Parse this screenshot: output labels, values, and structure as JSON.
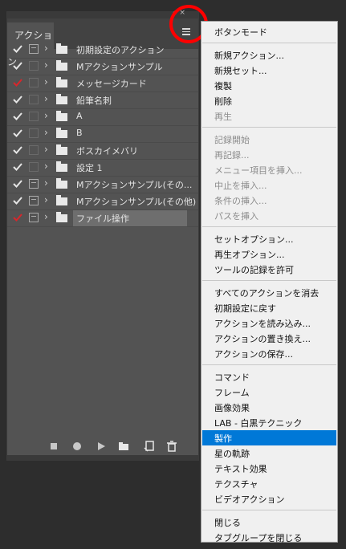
{
  "panel": {
    "tab_label": "アクション",
    "top_controls": "« ×",
    "actions": [
      {
        "label": "初期設定のアクション",
        "check": "white",
        "modal": "on"
      },
      {
        "label": "Mアクションサンプル",
        "check": "white",
        "modal": "empty"
      },
      {
        "label": "メッセージカード",
        "check": "red",
        "modal": "empty"
      },
      {
        "label": "鉛筆名刺",
        "check": "white",
        "modal": "empty"
      },
      {
        "label": "A",
        "check": "white",
        "modal": "empty"
      },
      {
        "label": "B",
        "check": "white",
        "modal": "empty"
      },
      {
        "label": "ボスカイメバリ",
        "check": "white",
        "modal": "empty"
      },
      {
        "label": "設定 1",
        "check": "white",
        "modal": "empty"
      },
      {
        "label": "Mアクションサンプル(その...",
        "check": "white",
        "modal": "on"
      },
      {
        "label": "Mアクションサンプル(その他)",
        "check": "white",
        "modal": "on"
      },
      {
        "label": "ファイル操作",
        "check": "red",
        "modal": "on"
      }
    ],
    "toolbar_icons": [
      "stop-icon",
      "record-icon",
      "play-icon",
      "new-set-icon",
      "new-action-icon",
      "trash-icon"
    ]
  },
  "menu": {
    "groups": [
      {
        "items": [
          {
            "label": "ボタンモード",
            "disabled": false
          }
        ]
      },
      {
        "items": [
          {
            "label": "新規アクション...",
            "disabled": false
          },
          {
            "label": "新規セット...",
            "disabled": false
          },
          {
            "label": "複製",
            "disabled": false
          },
          {
            "label": "削除",
            "disabled": false
          },
          {
            "label": "再生",
            "disabled": true
          }
        ]
      },
      {
        "items": [
          {
            "label": "記録開始",
            "disabled": true
          },
          {
            "label": "再記録...",
            "disabled": true
          },
          {
            "label": "メニュー項目を挿入...",
            "disabled": true
          },
          {
            "label": "中止を挿入...",
            "disabled": true
          },
          {
            "label": "条件の挿入...",
            "disabled": true
          },
          {
            "label": "パスを挿入",
            "disabled": true
          }
        ]
      },
      {
        "items": [
          {
            "label": "セットオプション...",
            "disabled": false
          },
          {
            "label": "再生オプション...",
            "disabled": false
          },
          {
            "label": "ツールの記録を許可",
            "disabled": false
          }
        ]
      },
      {
        "items": [
          {
            "label": "すべてのアクションを消去",
            "disabled": false
          },
          {
            "label": "初期設定に戻す",
            "disabled": false
          },
          {
            "label": "アクションを読み込み...",
            "disabled": false
          },
          {
            "label": "アクションの置き換え...",
            "disabled": false
          },
          {
            "label": "アクションの保存...",
            "disabled": false
          }
        ]
      },
      {
        "items": [
          {
            "label": "コマンド",
            "disabled": false
          },
          {
            "label": "フレーム",
            "disabled": false
          },
          {
            "label": "画像効果",
            "disabled": false
          },
          {
            "label": "LAB - 白黒テクニック",
            "disabled": false
          },
          {
            "label": "製作",
            "disabled": false,
            "selected": true
          },
          {
            "label": "星の軌跡",
            "disabled": false
          },
          {
            "label": "テキスト効果",
            "disabled": false
          },
          {
            "label": "テクスチャ",
            "disabled": false
          },
          {
            "label": "ビデオアクション",
            "disabled": false
          }
        ]
      },
      {
        "items": [
          {
            "label": "閉じる",
            "disabled": false
          },
          {
            "label": "タブグループを閉じる",
            "disabled": false
          }
        ]
      }
    ]
  },
  "colors": {
    "accent": "#0078d7",
    "red_check": "#d9262b",
    "highlight_circle": "#ff0000"
  }
}
